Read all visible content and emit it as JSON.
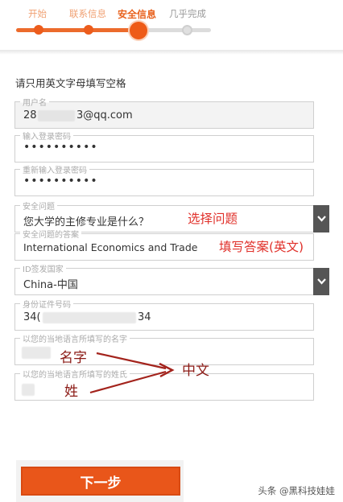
{
  "steps": [
    {
      "label": "开始",
      "state": "done"
    },
    {
      "label": "联系信息",
      "state": "done"
    },
    {
      "label": "安全信息",
      "state": "current"
    },
    {
      "label": "几乎完成",
      "state": "todo"
    }
  ],
  "form": {
    "instruction": "请只用英文字母填写空格",
    "username": {
      "label": "用户名",
      "value_prefix": "28",
      "value_suffix": "3@qq.com"
    },
    "password": {
      "label": "输入登录密码",
      "value": "••••••••••"
    },
    "password_confirm": {
      "label": "重新输入登录密码",
      "value": "••••••••••"
    },
    "security_question": {
      "label": "安全问题",
      "value": "您大学的主修专业是什么？"
    },
    "security_answer": {
      "label": "安全问题的答案",
      "value": "International Economics and Trade"
    },
    "id_country": {
      "label": "ID签发国家",
      "value": "China-中国"
    },
    "id_number": {
      "label": "身份证件号码",
      "value_prefix": "34(",
      "value_suffix": "34"
    },
    "local_first_name": {
      "label": "以您的当地语言所填写的名字"
    },
    "local_last_name": {
      "label": "以您的当地语言所填写的姓氏"
    }
  },
  "annotations": {
    "choose_question": "选择问题",
    "fill_answer": "填写答案(英文)",
    "first_name": "名字",
    "last_name": "姓",
    "chinese": "中文"
  },
  "next_button": "下一步",
  "watermark": "头条 @黑科技娃娃",
  "colors": {
    "accent": "#e9561a",
    "annotation": "#e0302a",
    "arrow": "#a3231c"
  }
}
